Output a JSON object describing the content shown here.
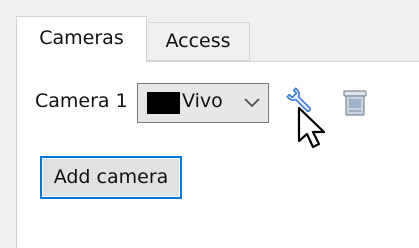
{
  "tabs": [
    {
      "label": "Cameras",
      "active": true
    },
    {
      "label": "Access",
      "active": false
    }
  ],
  "camera": {
    "label": "Camera 1",
    "selected_value": "Vivo",
    "swatch_color": "#000000"
  },
  "actions": {
    "settings_icon": "wrench-icon",
    "delete_icon": "trash-icon"
  },
  "add_button_label": "Add camera",
  "colors": {
    "focus_border": "#0078d7",
    "wrench_blue": "#3a7bd5"
  }
}
